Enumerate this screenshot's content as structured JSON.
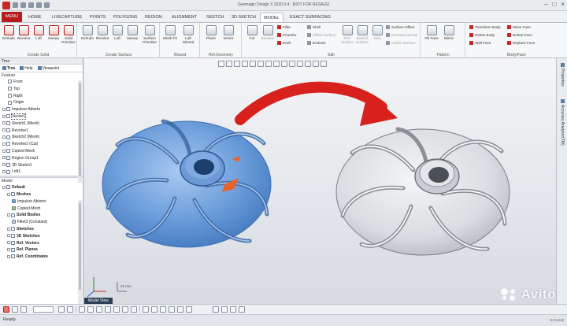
{
  "window": {
    "title": "Geomagic Design X 2020.0.4 - [NOT FOR RESALE]",
    "controls": [
      "–",
      "□",
      "×"
    ]
  },
  "tabs": [
    {
      "label": "MENU"
    },
    {
      "label": "HOME"
    },
    {
      "label": "LIVECAPTURE"
    },
    {
      "label": "POINTS"
    },
    {
      "label": "POLYGONS"
    },
    {
      "label": "REGION"
    },
    {
      "label": "ALIGNMENT"
    },
    {
      "label": "SKETCH"
    },
    {
      "label": "3D SKETCH"
    },
    {
      "label": "MODEL"
    },
    {
      "label": "EXACT SURFACING"
    }
  ],
  "active_tab": "MODEL",
  "ribbon": {
    "create_solid": {
      "label": "Create Solid",
      "buttons": [
        "Extrude",
        "Revolve",
        "Loft",
        "Sweep",
        "Solid Primitive"
      ]
    },
    "create_surface": {
      "label": "Create Surface",
      "buttons": [
        "Extrude",
        "Revolve",
        "Loft",
        "Sweep",
        "Surface Primitive"
      ]
    },
    "wizard": {
      "label": "Wizard",
      "buttons": [
        "Mesh Fit",
        "Loft Wizard"
      ]
    },
    "ref_geometry": {
      "label": "Ref.Geometry",
      "buttons": [
        "Plane",
        "Vector"
      ]
    },
    "edit": {
      "label": "Edit",
      "buttons": [
        "Cut",
        "Boolean"
      ],
      "small": [
        "Fillet",
        "Chamfer",
        "Draft",
        "Shell",
        "Offset Surface",
        "Emboss",
        "Trim Surface",
        "Extend Surface",
        "Sew",
        "Surface Offset",
        "Reverse Normal",
        "Untrim Surface"
      ]
    },
    "pattern": {
      "label": "Pattern",
      "buttons": [
        "Fill Face",
        "Mirror"
      ]
    },
    "body_face": {
      "label": "Body/Face",
      "small": [
        "Transform Body",
        "Delete Body",
        "Split Face",
        "Move Face",
        "Delete Face",
        "Replace Face"
      ]
    }
  },
  "left_panel": {
    "tree_header": "Tree",
    "tabs": [
      "Tree",
      "Help",
      "Viewpoint"
    ],
    "feature_label": "Feature",
    "feature_items": [
      {
        "label": "Front",
        "icon": "plane-icon"
      },
      {
        "label": "Top",
        "icon": "plane-icon"
      },
      {
        "label": "Right",
        "icon": "plane-icon"
      },
      {
        "label": "Origin",
        "icon": "origin-icon"
      },
      {
        "label": "Impulsor Abierto",
        "icon": "mesh-icon"
      },
      {
        "label": "Vector1",
        "icon": "vector-icon"
      },
      {
        "label": "Sketch1 (Mesh)",
        "icon": "sketch-icon"
      },
      {
        "label": "Revolve1",
        "icon": "revolve-icon"
      },
      {
        "label": "Sketch2 (Mesh)",
        "icon": "sketch-icon"
      },
      {
        "label": "Revolve2 (Cut)",
        "icon": "revolve-icon"
      },
      {
        "label": "Copied Mesh",
        "icon": "mesh-icon"
      },
      {
        "label": "Region Group1",
        "icon": "region-icon"
      },
      {
        "label": "3D Sketch1",
        "icon": "sketch3d-icon"
      },
      {
        "label": "Loft1",
        "icon": "loft-icon"
      }
    ],
    "model_label": "Model",
    "model_items": [
      {
        "label": "Default",
        "bold": true,
        "indent": 0
      },
      {
        "label": "Meshes",
        "bold": true,
        "indent": 1
      },
      {
        "label": "Impulsor Abierto",
        "bold": false,
        "indent": 2
      },
      {
        "label": "Copied Mesh",
        "bold": false,
        "indent": 2
      },
      {
        "label": "Solid Bodies",
        "bold": true,
        "indent": 1
      },
      {
        "label": "Fillet3 (Constant)",
        "bold": false,
        "indent": 2
      },
      {
        "label": "Sketches",
        "bold": true,
        "indent": 1
      },
      {
        "label": "3D Sketches",
        "bold": true,
        "indent": 1
      },
      {
        "label": "Ref. Vectors",
        "bold": true,
        "indent": 1
      },
      {
        "label": "Ref. Planes",
        "bold": true,
        "indent": 1
      },
      {
        "label": "Ref. Coordinates",
        "bold": true,
        "indent": 1
      }
    ]
  },
  "viewport": {
    "view_tab": "Model View",
    "scale_label": "25 mm",
    "colors": {
      "scan_mesh": "#6fa0dc",
      "cad_model": "#e6e8eb",
      "arrow": "#d8211c",
      "defect": "#e8632a"
    }
  },
  "right_strip": {
    "tabs": [
      "Properties",
      "Accuracy Analyzer(TM)"
    ]
  },
  "status": {
    "text": "Ready",
    "right": "0:3:1413"
  },
  "watermark": "Avito"
}
